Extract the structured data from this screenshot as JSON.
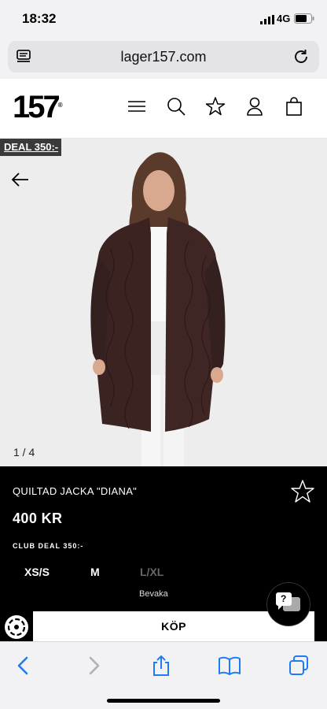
{
  "status_bar": {
    "time": "18:32",
    "network": "4G"
  },
  "browser": {
    "url": "lager157.com"
  },
  "site": {
    "logo": "157",
    "logo_mark": "®"
  },
  "hero": {
    "deal_badge": "DEAL 350:-",
    "image_counter": "1 / 4"
  },
  "product": {
    "name": "QUILTAD JACKA \"DIANA\"",
    "price": "400 KR",
    "club_deal": "CLUB DEAL 350:-",
    "sizes": [
      {
        "label": "XS/S",
        "available": true
      },
      {
        "label": "M",
        "available": true
      },
      {
        "label": "L/XL",
        "available": false
      }
    ],
    "notify_label": "Bevaka",
    "buy_label": "KÖP"
  },
  "chat": {
    "label": "?"
  },
  "colors": {
    "panel_bg": "#000000",
    "accent": "#1e7cf2",
    "coat": "#3b2322"
  }
}
